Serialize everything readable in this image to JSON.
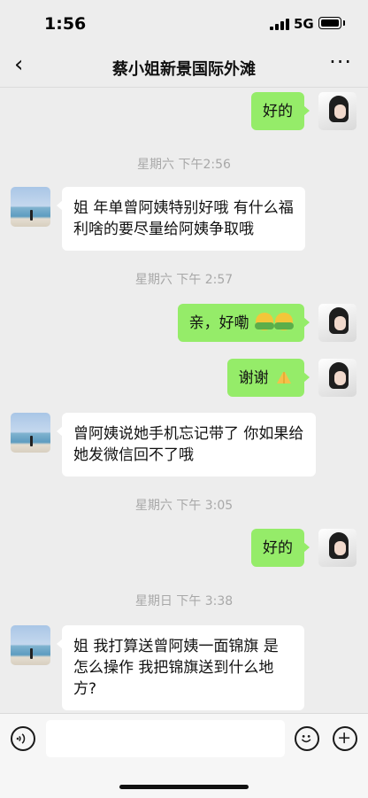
{
  "status_bar": {
    "time": "1:56",
    "network": "5G"
  },
  "header": {
    "back_glyph": "‹",
    "title": "蔡小姐新景国际外滩",
    "more_glyph": "···"
  },
  "messages": [
    {
      "side": "right",
      "text": "好的"
    },
    {
      "timestamp": "星期六 下午2:56"
    },
    {
      "side": "left",
      "text": "姐 年单曾阿姨特别好哦 有什么福利啥的要尽量给阿姨争取哦"
    },
    {
      "timestamp": "星期六 下午 2:57"
    },
    {
      "side": "right",
      "text": "亲，好嘞",
      "emoji": [
        "hugging-face-emoji",
        "hugging-face-emoji"
      ]
    },
    {
      "side": "right",
      "text": "谢谢",
      "emoji": [
        "praying-hands-emoji"
      ]
    },
    {
      "side": "left",
      "text": "曾阿姨说她手机忘记带了 你如果给她发微信回不了哦"
    },
    {
      "timestamp": "星期六 下午 3:05"
    },
    {
      "side": "right",
      "text": "好的"
    },
    {
      "timestamp": "星期日 下午 3:38"
    },
    {
      "side": "left",
      "text": "姐 我打算送曾阿姨一面锦旗 是怎么操作 我把锦旗送到什么地方?"
    }
  ],
  "input_bar": {
    "voice_icon": "voice-icon",
    "emoji_icon": "smiley-icon",
    "plus_icon": "plus-icon"
  },
  "colors": {
    "background": "#ededed",
    "bubble_self": "#95ec69",
    "bubble_other": "#ffffff",
    "timestamp": "#a8a8a8"
  }
}
